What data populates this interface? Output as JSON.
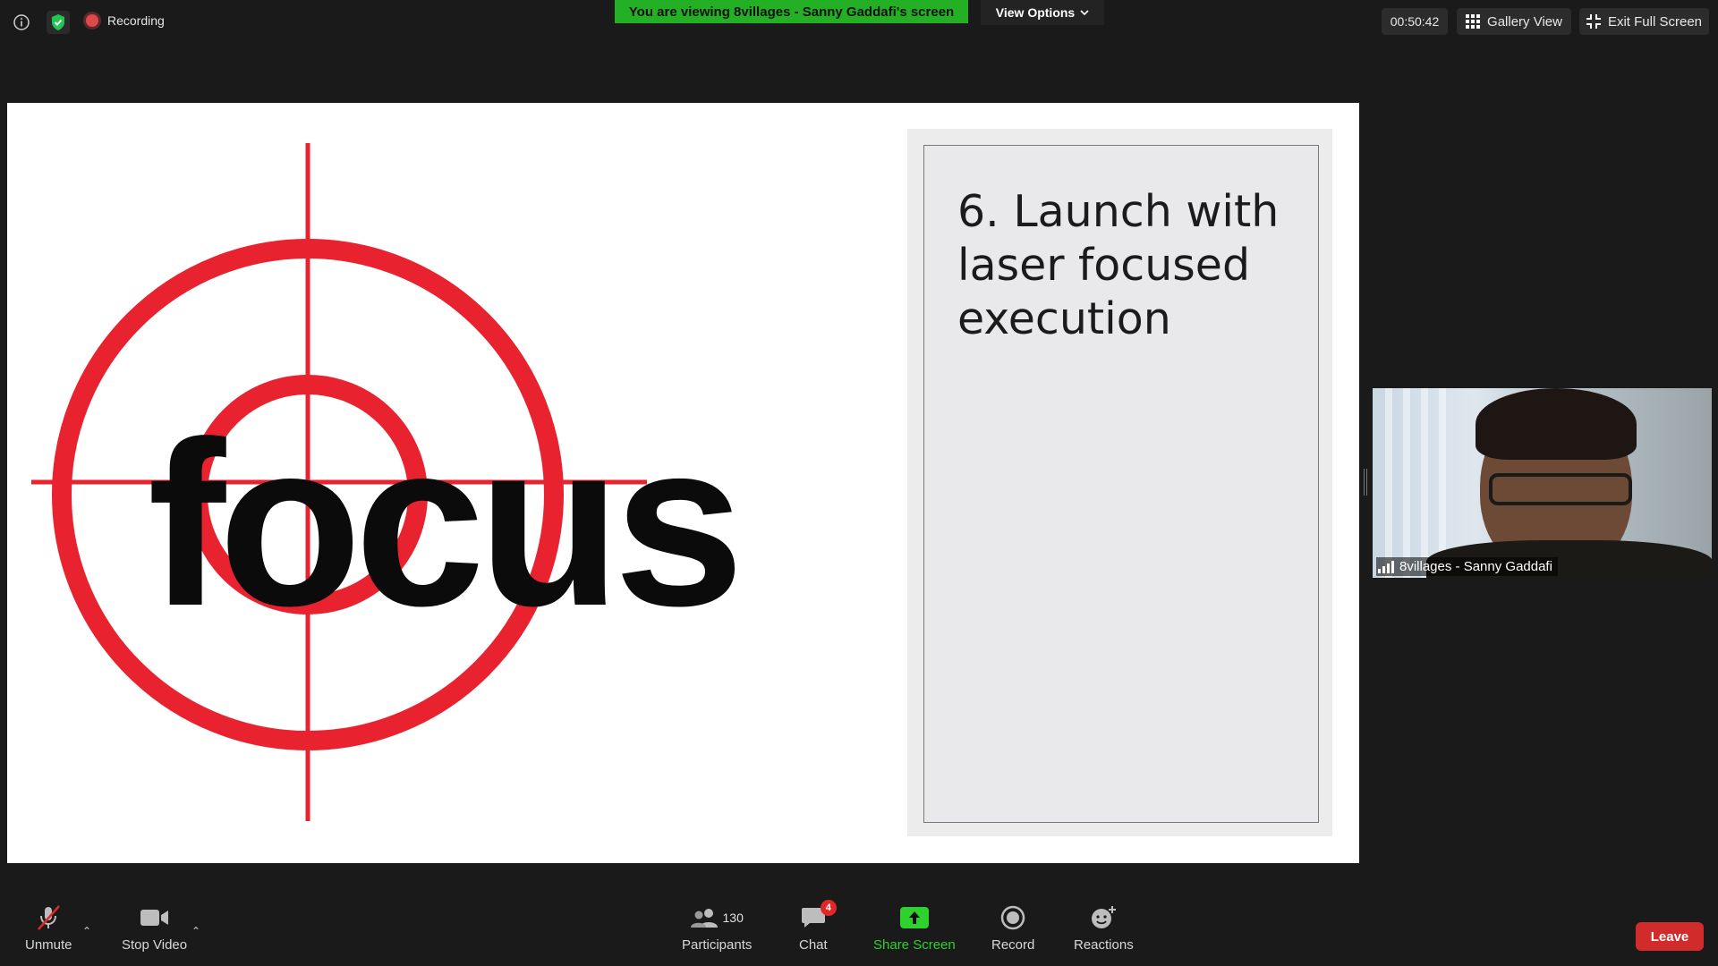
{
  "top_bar": {
    "recording_label": "Recording",
    "banner_text": "You are viewing 8villages - Sanny Gaddafi's screen",
    "view_options_label": "View Options",
    "timer": "00:50:42",
    "gallery_view_label": "Gallery View",
    "exit_full_screen_label": "Exit Full Screen"
  },
  "shared_screen": {
    "focus_word": "focus",
    "slide_title": "6. Launch with laser focused execution"
  },
  "video": {
    "participant_name": "8villages - Sanny Gaddafi"
  },
  "toolbar": {
    "unmute_label": "Unmute",
    "stop_video_label": "Stop Video",
    "participants_label": "Participants",
    "participants_count": "130",
    "chat_label": "Chat",
    "chat_badge": "4",
    "share_screen_label": "Share Screen",
    "record_label": "Record",
    "reactions_label": "Reactions",
    "leave_label": "Leave"
  },
  "colors": {
    "banner_green": "#24b024",
    "share_green": "#2fd12f",
    "leave_red": "#d12b2b",
    "target_red": "#e8232f"
  },
  "icons": [
    "info-icon",
    "shield-check-icon",
    "recording-dot-icon",
    "chevron-down-icon",
    "grid-icon",
    "exit-fullscreen-icon",
    "signal-bars-icon",
    "mic-muted-icon",
    "video-camera-icon",
    "participants-icon",
    "chat-icon",
    "share-arrow-icon",
    "record-icon",
    "reactions-icon"
  ]
}
